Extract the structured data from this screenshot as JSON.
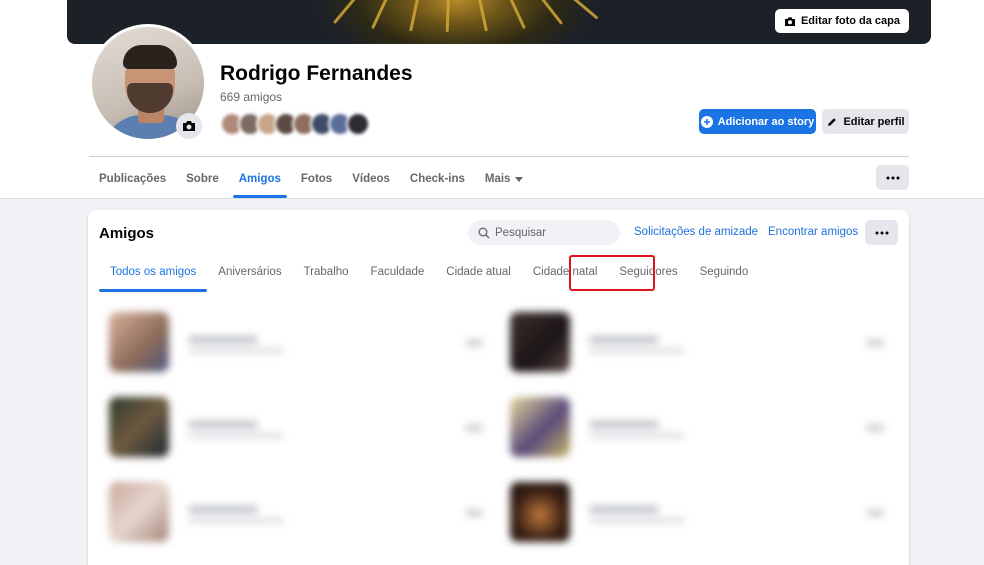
{
  "cover": {
    "edit_label": "Editar foto da capa"
  },
  "profile": {
    "name": "Rodrigo Fernandes",
    "friends_count": "669 amigos",
    "add_story_label": "Adicionar ao story",
    "edit_profile_label": "Editar perfil"
  },
  "profile_tabs": [
    {
      "label": "Publicações"
    },
    {
      "label": "Sobre"
    },
    {
      "label": "Amigos",
      "active": true
    },
    {
      "label": "Fotos"
    },
    {
      "label": "Vídeos"
    },
    {
      "label": "Check-ins"
    },
    {
      "label": "Mais"
    }
  ],
  "friends_card": {
    "title": "Amigos",
    "search_placeholder": "Pesquisar",
    "requests_link": "Solicitações de amizade",
    "find_link": "Encontrar amigos",
    "tabs": [
      {
        "label": "Todos os amigos",
        "active": true
      },
      {
        "label": "Aniversários"
      },
      {
        "label": "Trabalho"
      },
      {
        "label": "Faculdade"
      },
      {
        "label": "Cidade atual"
      },
      {
        "label": "Cidade natal"
      },
      {
        "label": "Seguidores",
        "highlighted": true
      },
      {
        "label": "Seguindo"
      }
    ]
  },
  "colors": {
    "accent": "#1b74e4",
    "highlight_box": "#e0141e",
    "page_bg": "#f0f2f5"
  }
}
